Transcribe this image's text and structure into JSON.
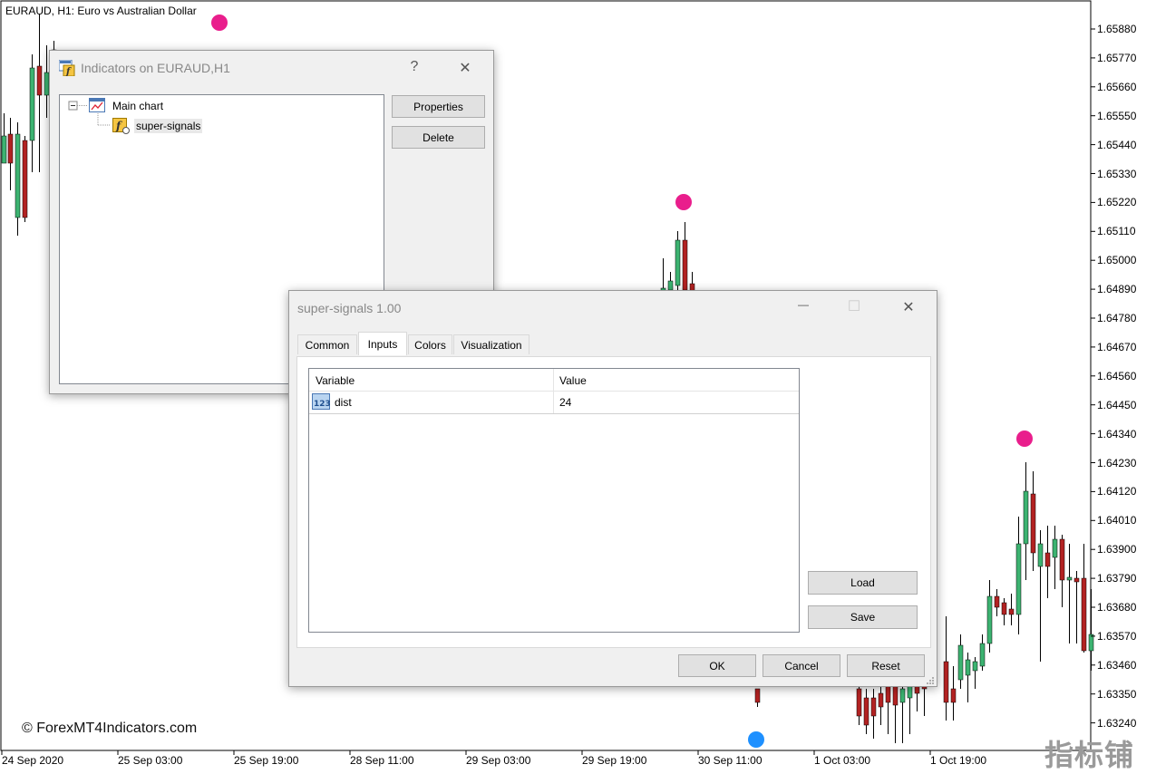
{
  "chart": {
    "title": "EURAUD, H1:  Euro vs Australian Dollar",
    "price_labels": [
      "1.65880",
      "1.65770",
      "1.65660",
      "1.65550",
      "1.65440",
      "1.65330",
      "1.65220",
      "1.65110",
      "1.65000",
      "1.64890",
      "1.64780",
      "1.64670",
      "1.64560",
      "1.64450",
      "1.64340",
      "1.64230",
      "1.64120",
      "1.64010",
      "1.63900",
      "1.63790",
      "1.63680",
      "1.63570",
      "1.63460",
      "1.63350",
      "1.63240"
    ],
    "time_labels": [
      "24 Sep 2020",
      "25 Sep 03:00",
      "25 Sep 19:00",
      "28 Sep 11:00",
      "29 Sep 03:00",
      "29 Sep 19:00",
      "30 Sep 11:00",
      "1 Oct 03:00",
      "1 Oct 19:00"
    ],
    "watermark": "© ForexMT4Indicators.com",
    "brand": "指标铺",
    "colors": {
      "bull": "#3cb371",
      "bear": "#b22222",
      "sell_signal": "#e91e8c",
      "buy_signal": "#1e90ff"
    }
  },
  "indicators_dialog": {
    "title": "Indicators on EURAUD,H1",
    "help_label": "?",
    "close_label": "✕",
    "tree": {
      "root": "Main chart",
      "child": "super-signals"
    },
    "buttons": {
      "properties": "Properties",
      "delete": "Delete"
    }
  },
  "props_dialog": {
    "title": "super-signals 1.00",
    "min_label": "—",
    "max_label": "☐",
    "close_label": "✕",
    "tabs": [
      "Common",
      "Inputs",
      "Colors",
      "Visualization"
    ],
    "active_tab": "Inputs",
    "grid": {
      "headers": [
        "Variable",
        "Value"
      ],
      "rows": [
        {
          "icon": "123",
          "variable": "dist",
          "value": "24"
        }
      ]
    },
    "buttons": {
      "load": "Load",
      "save": "Save",
      "ok": "OK",
      "cancel": "Cancel",
      "reset": "Reset"
    }
  }
}
